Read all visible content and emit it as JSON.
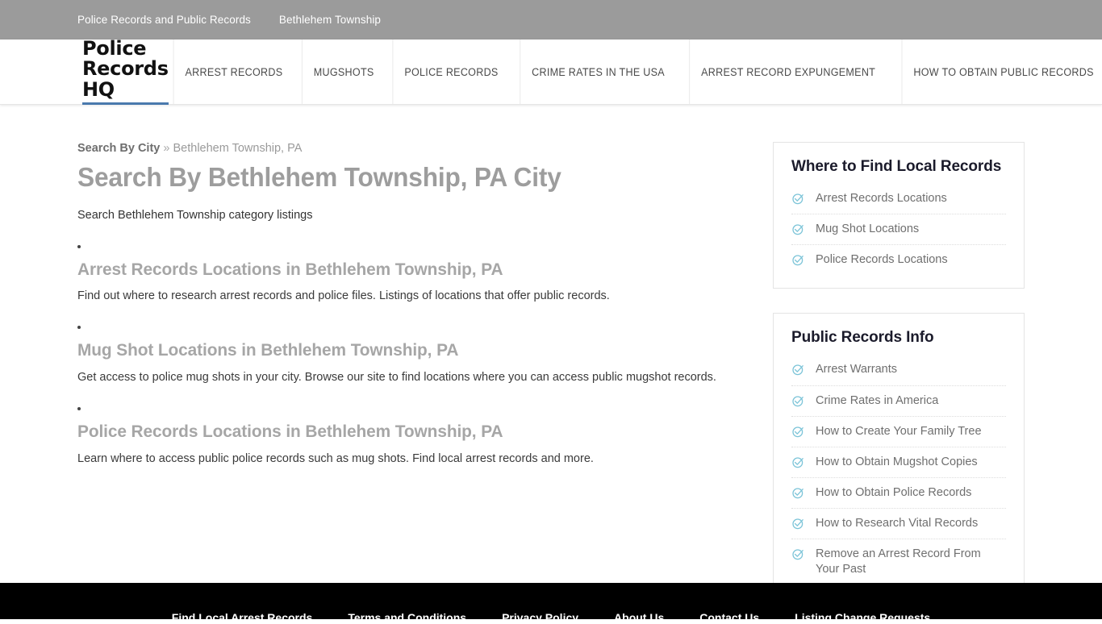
{
  "topbar": {
    "links": [
      {
        "label": "Police Records and Public Records"
      },
      {
        "label": "Bethlehem Township"
      }
    ]
  },
  "header": {
    "logo": "Police Records HQ",
    "nav": [
      {
        "label": "ARREST RECORDS"
      },
      {
        "label": "MUGSHOTS"
      },
      {
        "label": "POLICE RECORDS"
      },
      {
        "label": "CRIME RATES IN THE USA"
      },
      {
        "label": "ARREST RECORD EXPUNGEMENT"
      },
      {
        "label": "HOW TO OBTAIN PUBLIC RECORDS"
      }
    ]
  },
  "breadcrumb": {
    "root": "Search By City",
    "separator": "»",
    "current": "Bethlehem Township, PA"
  },
  "main": {
    "title": "Search By Bethlehem Township, PA City",
    "intro": "Search Bethlehem Township category listings",
    "entries": [
      {
        "title": "Arrest Records Locations in Bethlehem Township, PA",
        "desc": "Find out where to research arrest records and police files. Listings of locations that offer public records."
      },
      {
        "title": "Mug Shot Locations in Bethlehem Township, PA",
        "desc": "Get access to police mug shots in your city. Browse our site to find locations where you can access public mugshot records."
      },
      {
        "title": "Police Records Locations in Bethlehem Township, PA",
        "desc": "Learn where to access public police records such as mug shots. Find local arrest records and more."
      }
    ]
  },
  "sidebar": {
    "widgets": [
      {
        "title": "Where to Find Local Records",
        "items": [
          {
            "label": "Arrest Records Locations"
          },
          {
            "label": "Mug Shot Locations"
          },
          {
            "label": "Police Records Locations"
          }
        ]
      },
      {
        "title": "Public Records Info",
        "items": [
          {
            "label": "Arrest Warrants"
          },
          {
            "label": "Crime Rates in America"
          },
          {
            "label": "How to Create Your Family Tree"
          },
          {
            "label": "How to Obtain Mugshot Copies"
          },
          {
            "label": "How to Obtain Police Records"
          },
          {
            "label": "How to Research Vital Records"
          },
          {
            "label": "Remove an Arrest Record From Your Past"
          }
        ]
      }
    ]
  },
  "footer": {
    "links": [
      {
        "label": "Find Local Arrest Records"
      },
      {
        "label": "Terms and Conditions"
      },
      {
        "label": "Privacy Policy"
      },
      {
        "label": "About Us"
      },
      {
        "label": "Contact Us"
      },
      {
        "label": "Listing Change Requests"
      }
    ]
  },
  "colors": {
    "topbar_bg": "#9b9b9b",
    "logo_underline": "#4a79ad",
    "check_icon": "#7cc4d8",
    "heading_gray": "#9d9d9d",
    "footer_bg": "#000000"
  }
}
